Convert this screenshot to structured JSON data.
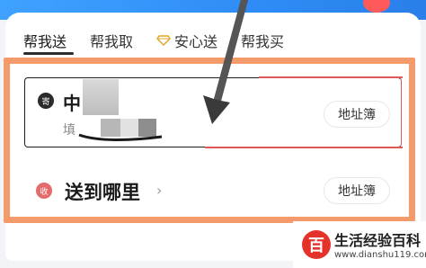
{
  "tabs": [
    {
      "label": "帮我送",
      "active": true
    },
    {
      "label": "帮我取",
      "active": false
    },
    {
      "label": "安心送",
      "active": false,
      "icon": "diamond-icon"
    },
    {
      "label": "帮我买",
      "active": false
    }
  ],
  "sender": {
    "badge": "寄",
    "name": "中",
    "subtitle": "填",
    "address_book_label": "地址簿"
  },
  "destination": {
    "badge": "收",
    "title": "送到哪里",
    "chevron": "›",
    "address_book_label": "地址簿"
  },
  "watermark": {
    "logo": "百",
    "title": "生活经验百科",
    "url": "www.dianshu119.com"
  },
  "colors": {
    "accent_blue": "#2f8cf6",
    "highlight_orange": "#f59a6a",
    "receive_red": "#e56a6a",
    "watermark_red": "#e4322b"
  }
}
